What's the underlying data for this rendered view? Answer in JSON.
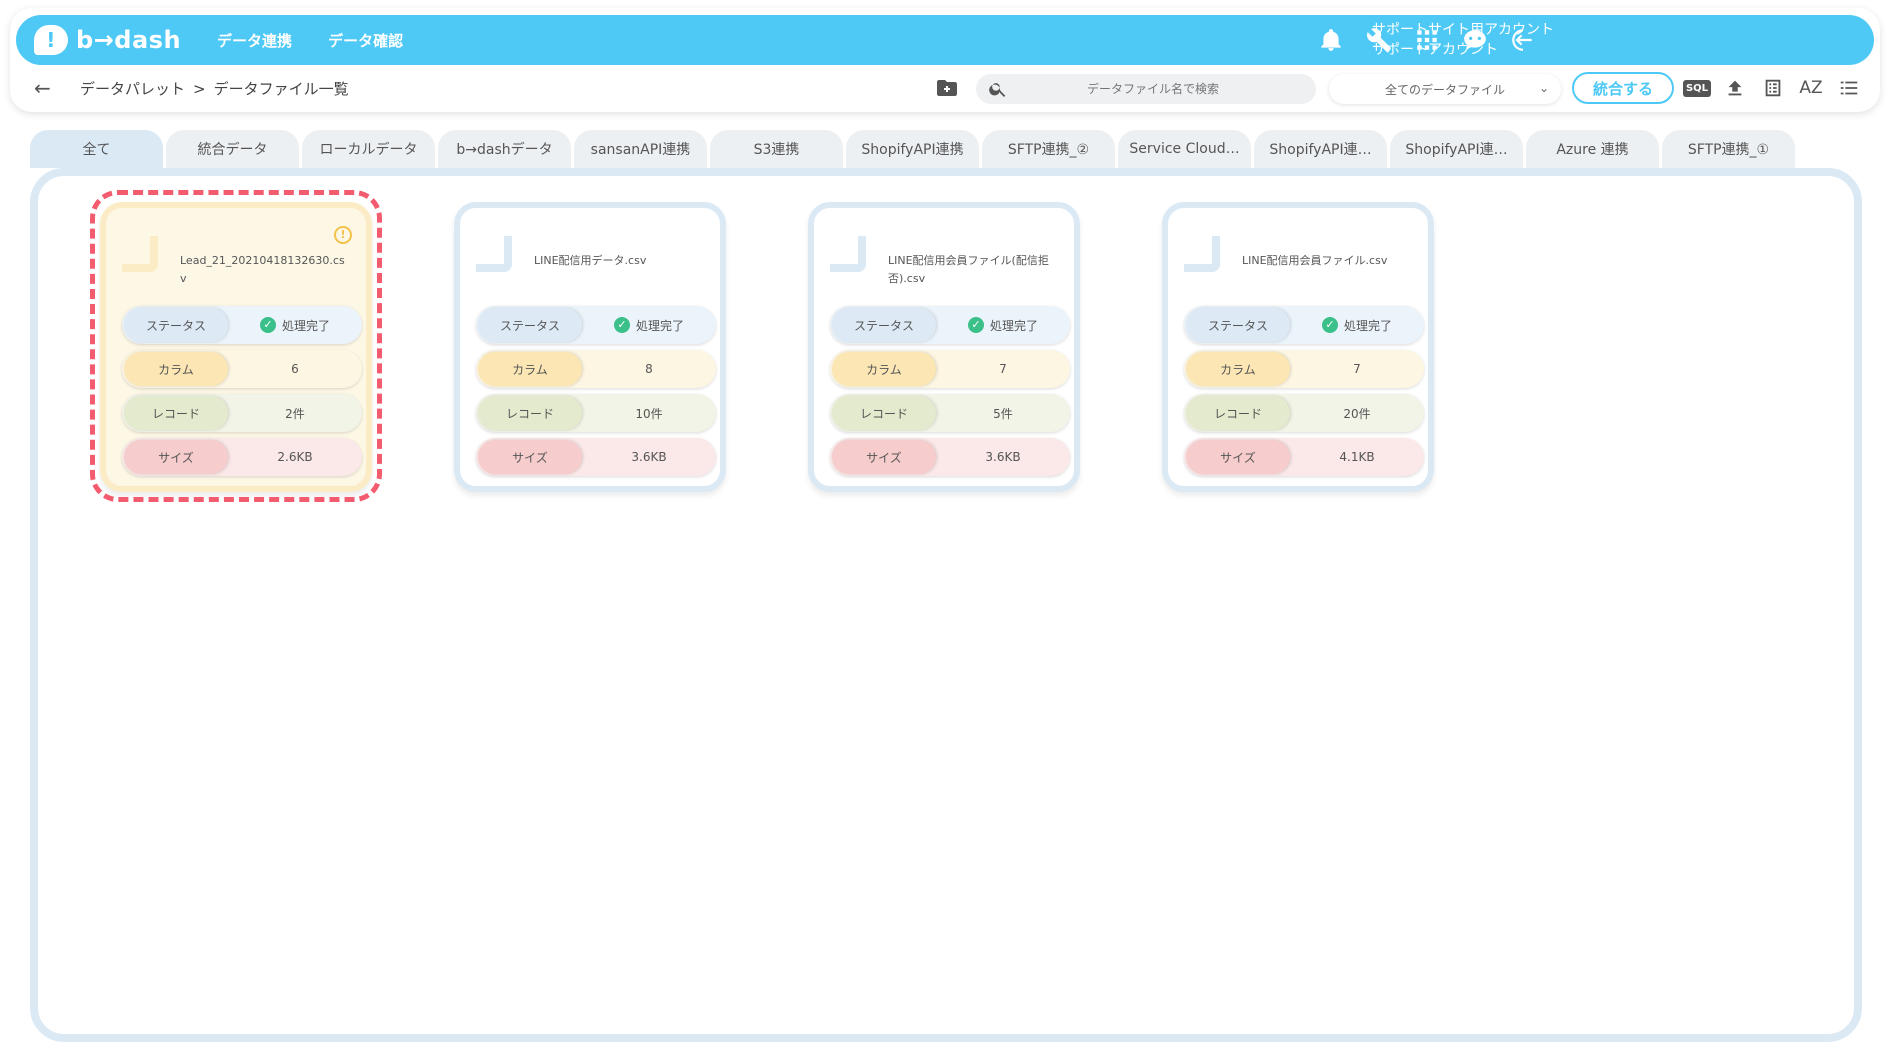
{
  "header": {
    "logo_text": "b→dash",
    "nav": [
      "データ連携",
      "データ確認"
    ],
    "account_line1": "サポートサイト用アカウント",
    "account_line2": "サポートアカウント"
  },
  "toolbar": {
    "breadcrumb_root": "データパレット",
    "breadcrumb_sep": ">",
    "breadcrumb_current": "データファイル一覧",
    "search_placeholder": "データファイル名で検索",
    "filter_selected": "全てのデータファイル",
    "merge_label": "統合する",
    "sql_label": "SQL",
    "sort_label": "AZ"
  },
  "tabs": [
    "全て",
    "統合データ",
    "ローカルデータ",
    "b→dashデータ",
    "sansanAPI連携",
    "S3連携",
    "ShopifyAPI連携",
    "SFTP連携_②",
    "Service Cloud…",
    "ShopifyAPI連…",
    "ShopifyAPI連…",
    "Azure 連携",
    "SFTP連携_①"
  ],
  "labels": {
    "status": "ステータス",
    "column": "カラム",
    "record": "レコード",
    "size": "サイズ"
  },
  "cards": [
    {
      "name": "Lead_21_20210418132630.csv",
      "status": "処理完了",
      "columns": "6",
      "records": "2件",
      "size": "2.6KB"
    },
    {
      "name": "LINE配信用データ.csv",
      "status": "処理完了",
      "columns": "8",
      "records": "10件",
      "size": "3.6KB"
    },
    {
      "name": "LINE配信用会員ファイル(配信拒否).csv",
      "status": "処理完了",
      "columns": "7",
      "records": "5件",
      "size": "3.6KB"
    },
    {
      "name": "LINE配信用会員ファイル.csv",
      "status": "処理完了",
      "columns": "7",
      "records": "20件",
      "size": "4.1KB"
    }
  ],
  "colors": {
    "brand": "#4ec9f5",
    "highlight": "#f25c6e",
    "success": "#3cc08a",
    "warning": "#f4c24a"
  },
  "icons": [
    "bell-icon",
    "wrench-icon",
    "apps-grid-icon",
    "chat-bot-icon",
    "logout-icon",
    "back-arrow-icon",
    "folder-add-icon",
    "search-icon",
    "chevron-down-icon",
    "sql-icon",
    "upload-icon",
    "list-view-icon",
    "sort-az-icon",
    "menu-list-icon",
    "check-circle-icon",
    "warning-icon"
  ]
}
